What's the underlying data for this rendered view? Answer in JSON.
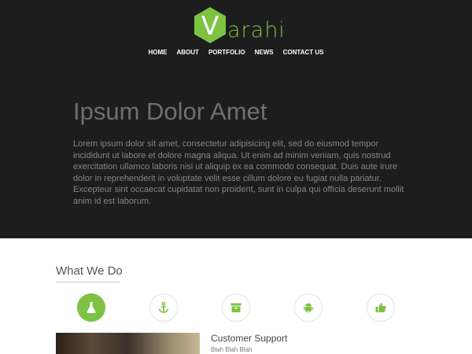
{
  "brand": {
    "initial": "V",
    "rest": "arahi",
    "accent": "#7dc242"
  },
  "nav": [
    "HOME",
    "ABOUT",
    "PORTFOLIO",
    "NEWS",
    "CONTACT US"
  ],
  "hero": {
    "title": "Ipsum Dolor Amet",
    "body": "Lorem ipsum dolor sit amet, consectetur adipisicing elit, sed do eiusmod tempor incididunt ut labore et dolore magna aliqua. Ut enim ad minim veniam, quis nostrud exercitation ullamco laboris nisi ut aliquip ex ea commodo consequat. Duis aute irure dolor in reprehenderit in voluptate velit esse cillum dolore eu fugiat nulla pariatur. Excepteur sint occaecat cupidatat non proident, sunt in culpa qui officia deserunt mollit anim id est laborum."
  },
  "section": {
    "title": "What We Do",
    "icons": [
      "flask-icon",
      "anchor-icon",
      "archive-icon",
      "android-icon",
      "thumbs-up-icon"
    ]
  },
  "feature": {
    "title": "Customer Support",
    "subtitle": "Blah Blah Blah"
  }
}
